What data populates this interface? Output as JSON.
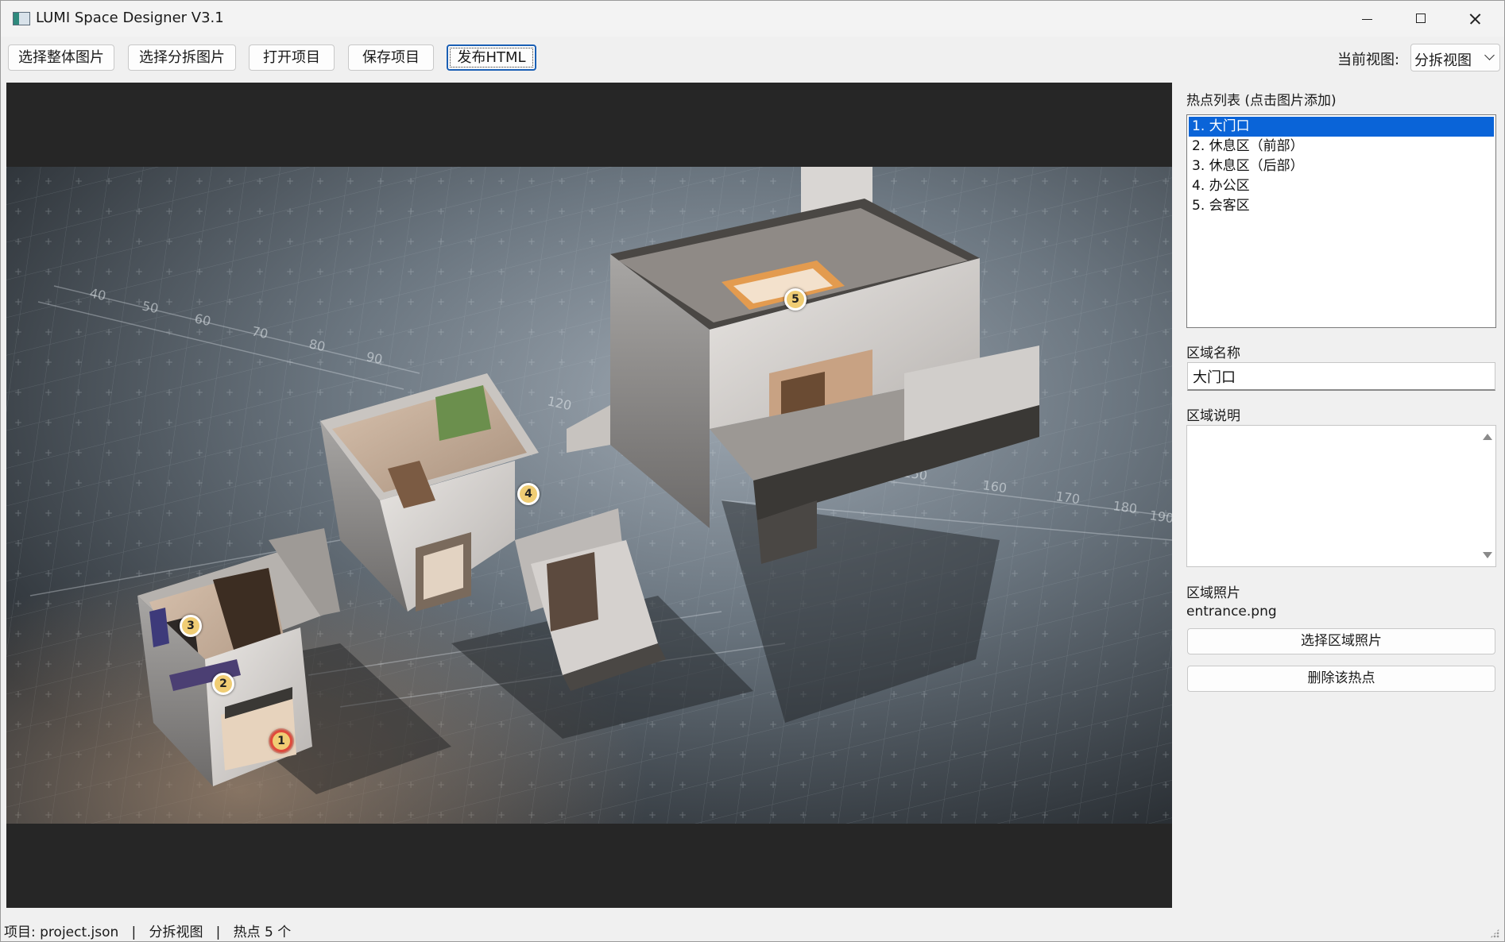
{
  "window": {
    "title": "LUMI Space Designer V3.1"
  },
  "toolbar": {
    "select_whole_image": "选择整体图片",
    "select_exploded_image": "选择分拆图片",
    "open_project": "打开项目",
    "save_project": "保存项目",
    "publish_html": "发布HTML",
    "current_view_label": "当前视图:",
    "current_view_value": "分拆视图"
  },
  "canvas": {
    "scale_numbers_right": [
      "150",
      "160",
      "170",
      "180",
      "190"
    ],
    "scale_numbers_left": [
      "40",
      "50",
      "60",
      "70",
      "80",
      "90",
      "120"
    ],
    "hotspots": [
      {
        "number": "1",
        "selected": true
      },
      {
        "number": "2",
        "selected": false
      },
      {
        "number": "3",
        "selected": false
      },
      {
        "number": "4",
        "selected": false
      },
      {
        "number": "5",
        "selected": false
      }
    ]
  },
  "panel": {
    "hotspot_list_label": "热点列表 (点击图片添加)",
    "hotspot_list": [
      "1. 大门口",
      "2. 休息区（前部）",
      "3. 休息区（后部）",
      "4. 办公区",
      "5. 会客区"
    ],
    "selected_index": 0,
    "area_name_label": "区域名称",
    "area_name_value": "大门口",
    "area_desc_label": "区域说明",
    "area_desc_value": "",
    "area_photo_label": "区域照片",
    "area_photo_filename": "entrance.png",
    "select_photo_button": "选择区域照片",
    "delete_hotspot_button": "删除该热点"
  },
  "statusbar": {
    "text": "项目: project.json   |   分拆视图   |   热点 5 个"
  },
  "colors": {
    "selection_blue": "#0a64d8",
    "hotspot_fill": "#f0cd74",
    "hotspot_selected_ring": "#e04a3c",
    "canvas_background": "#262626"
  }
}
